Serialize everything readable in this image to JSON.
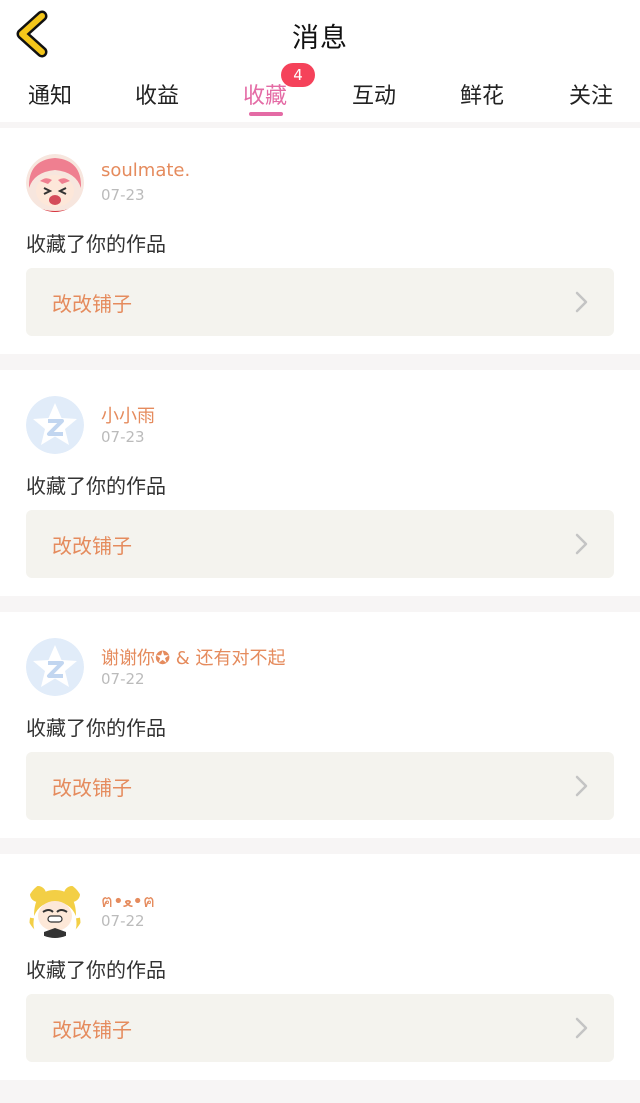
{
  "header": {
    "title": "消息",
    "back_icon": "chevron-left-icon"
  },
  "tabs": [
    {
      "label": "通知"
    },
    {
      "label": "收益"
    },
    {
      "label": "收藏",
      "badge": "4",
      "active": true
    },
    {
      "label": "互动"
    },
    {
      "label": "鲜花"
    },
    {
      "label": "关注"
    }
  ],
  "messages": [
    {
      "user": "soulmate.",
      "date": "07-23",
      "action": "收藏了你的作品",
      "work": "改改铺子",
      "avatar": "anime-girl-avatar"
    },
    {
      "user": "小小雨",
      "date": "07-23",
      "action": "收藏了你的作品",
      "work": "改改铺子",
      "avatar": "default-qzone-avatar"
    },
    {
      "user": "谢谢你✪ & 还有对不起",
      "date": "07-22",
      "action": "收藏了你的作品",
      "work": "改改铺子",
      "avatar": "default-qzone-avatar"
    },
    {
      "user": "ฅ•ﻌ•ฅ",
      "date": "07-22",
      "action": "收藏了你的作品",
      "work": "改改铺子",
      "avatar": "sailor-moon-avatar"
    }
  ],
  "colors": {
    "accent": "#e46ba5",
    "badge": "#f5425a",
    "name": "#e58b5d",
    "back": "#f4c61a"
  }
}
